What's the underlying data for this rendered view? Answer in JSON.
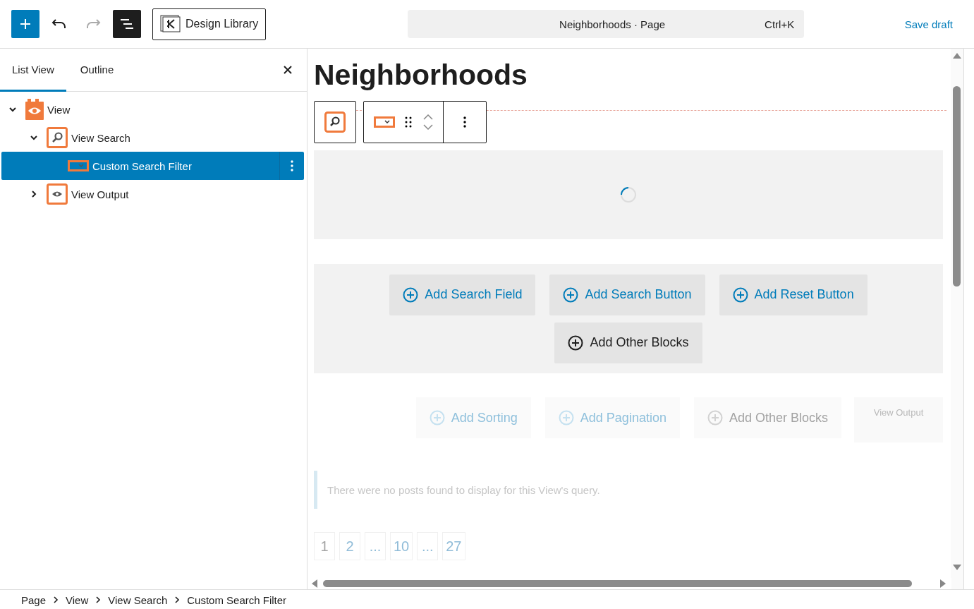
{
  "top_bar": {
    "tools": [
      {
        "kind": "add",
        "disabled": false
      },
      {
        "kind": "undo",
        "disabled": false
      },
      {
        "kind": "redo",
        "disabled": true
      }
    ],
    "list_view_toggle": {
      "on": true
    },
    "design_library": "Design Library",
    "command": {
      "title": "Neighborhoods · Page",
      "shortcut": "Ctrl+K"
    },
    "save_draft": "Save draft"
  },
  "sidebar": {
    "tabs": [
      {
        "label": "List View",
        "selected": true
      },
      {
        "label": "Outline",
        "selected": false
      }
    ],
    "tree": [
      {
        "label": "View",
        "kind": "view",
        "expanded": true,
        "selected": false,
        "children": [
          {
            "label": "View Search",
            "kind": "search",
            "expanded": true,
            "selected": false,
            "children": [
              {
                "label": "Custom Search Filter",
                "kind": "filter",
                "selected": true
              }
            ]
          },
          {
            "label": "View Output",
            "kind": "output",
            "expanded": false,
            "selected": false
          }
        ]
      }
    ]
  },
  "canvas": {
    "title": "Neighborhoods",
    "search_buttons": [
      {
        "label": "Add Search Field",
        "kind": "primary"
      },
      {
        "label": "Add Search Button",
        "kind": "primary"
      },
      {
        "label": "Add Reset Button",
        "kind": "primary"
      },
      {
        "label": "Add Other Blocks",
        "kind": "other"
      }
    ],
    "output_buttons": [
      {
        "label": "Add Sorting",
        "kind": "primary"
      },
      {
        "label": "Add Pagination",
        "kind": "primary"
      },
      {
        "label": "Add Other Blocks",
        "kind": "other"
      }
    ],
    "output_label": "View Output",
    "message": "There were no posts found to display for this View's query.",
    "pagination": [
      "1",
      "2",
      "...",
      "10",
      "...",
      "27"
    ]
  },
  "breadcrumbs": [
    "Page",
    "View",
    "View Search",
    "Custom Search Filter"
  ]
}
